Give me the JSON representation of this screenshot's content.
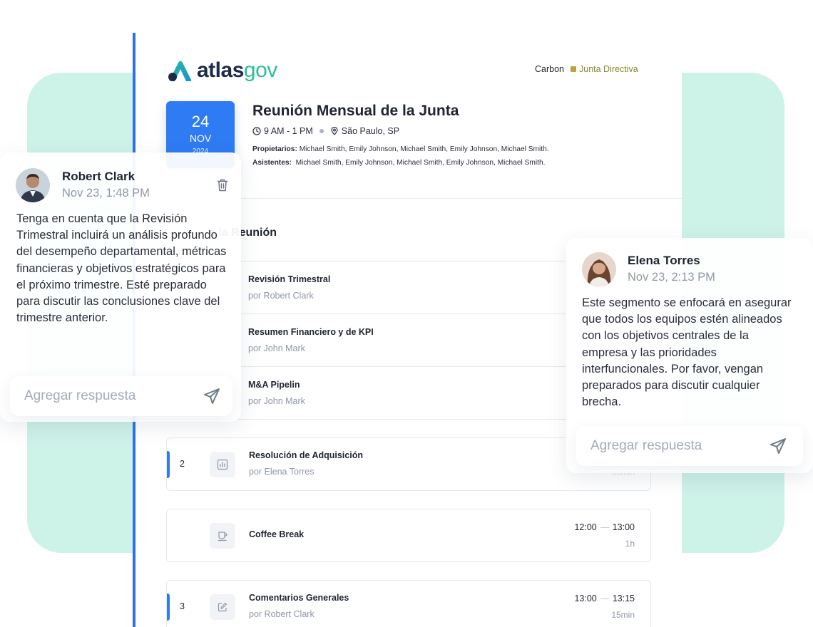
{
  "brand": {
    "logo_main": "atlas",
    "logo_accent": "gov"
  },
  "header": {
    "org": "Carbon",
    "committee": "Junta Directiva",
    "committee_color": "#b7a63c"
  },
  "meeting": {
    "day": "24",
    "month": "NOV",
    "year": "2024",
    "title": "Reunión Mensual de la Junta",
    "time": "9 AM - 1 PM",
    "location": "São Paulo, SP",
    "owners_label": "Propietarios:",
    "owners": "Michael Smith, Emily Johnson, Michael Smith, Emily Johnson, Michael Smith.",
    "attendees_label": "Asistentes:",
    "attendees": "Michael Smith, Emily Johnson, Michael Smith, Emily Johnson, Michael Smith."
  },
  "agenda": {
    "section_title": "Agenda de la Reunión",
    "section_title_visible": "e la Reunión",
    "subitems": [
      {
        "title": "Revisión Trimestral",
        "by": "por Robert Clark"
      },
      {
        "title": "Resumen Financiero y de KPI",
        "by": "por John Mark"
      },
      {
        "title": "M&A Pipelin",
        "by": "por John Mark"
      }
    ],
    "items": [
      {
        "num": "2",
        "icon": "chart-icon",
        "title": "Resolución de Adquisición",
        "by": "por Elena Torres",
        "duration": "30min"
      },
      {
        "num": "",
        "icon": "coffee-icon",
        "title": "Coffee Break",
        "start": "12:00",
        "end": "13:00",
        "duration": "1h"
      },
      {
        "num": "3",
        "icon": "edit-icon",
        "title": "Comentarios Generales",
        "by": "por Robert Clark",
        "start": "13:00",
        "end": "13:15",
        "duration": "15min"
      }
    ]
  },
  "comments": [
    {
      "author": "Robert Clark",
      "date": "Nov 23, 1:48 PM",
      "body": "Tenga en cuenta que la Revisión Trimestral incluirá un análisis profundo del desempeño departamental, métricas financieras y objetivos estratégicos para el próximo trimestre. Esté preparado para discutir las conclusiones clave del trimestre anterior.",
      "reply_placeholder": "Agregar respuesta"
    },
    {
      "author": "Elena Torres",
      "date": "Nov 23, 2:13 PM",
      "body": "Este segmento se enfocará en asegurar que todos los equipos estén alineados con los objetivos centrales de la empresa y las prioridades interfuncionales. Por favor, vengan preparados para discutir cualquier brecha.",
      "reply_placeholder": "Agregar respuesta"
    }
  ],
  "colors": {
    "accent": "#2f7bf3",
    "mint": "#cdf2e8",
    "brand_dark": "#1d2b4a",
    "brand_teal": "#2bbd9e"
  }
}
